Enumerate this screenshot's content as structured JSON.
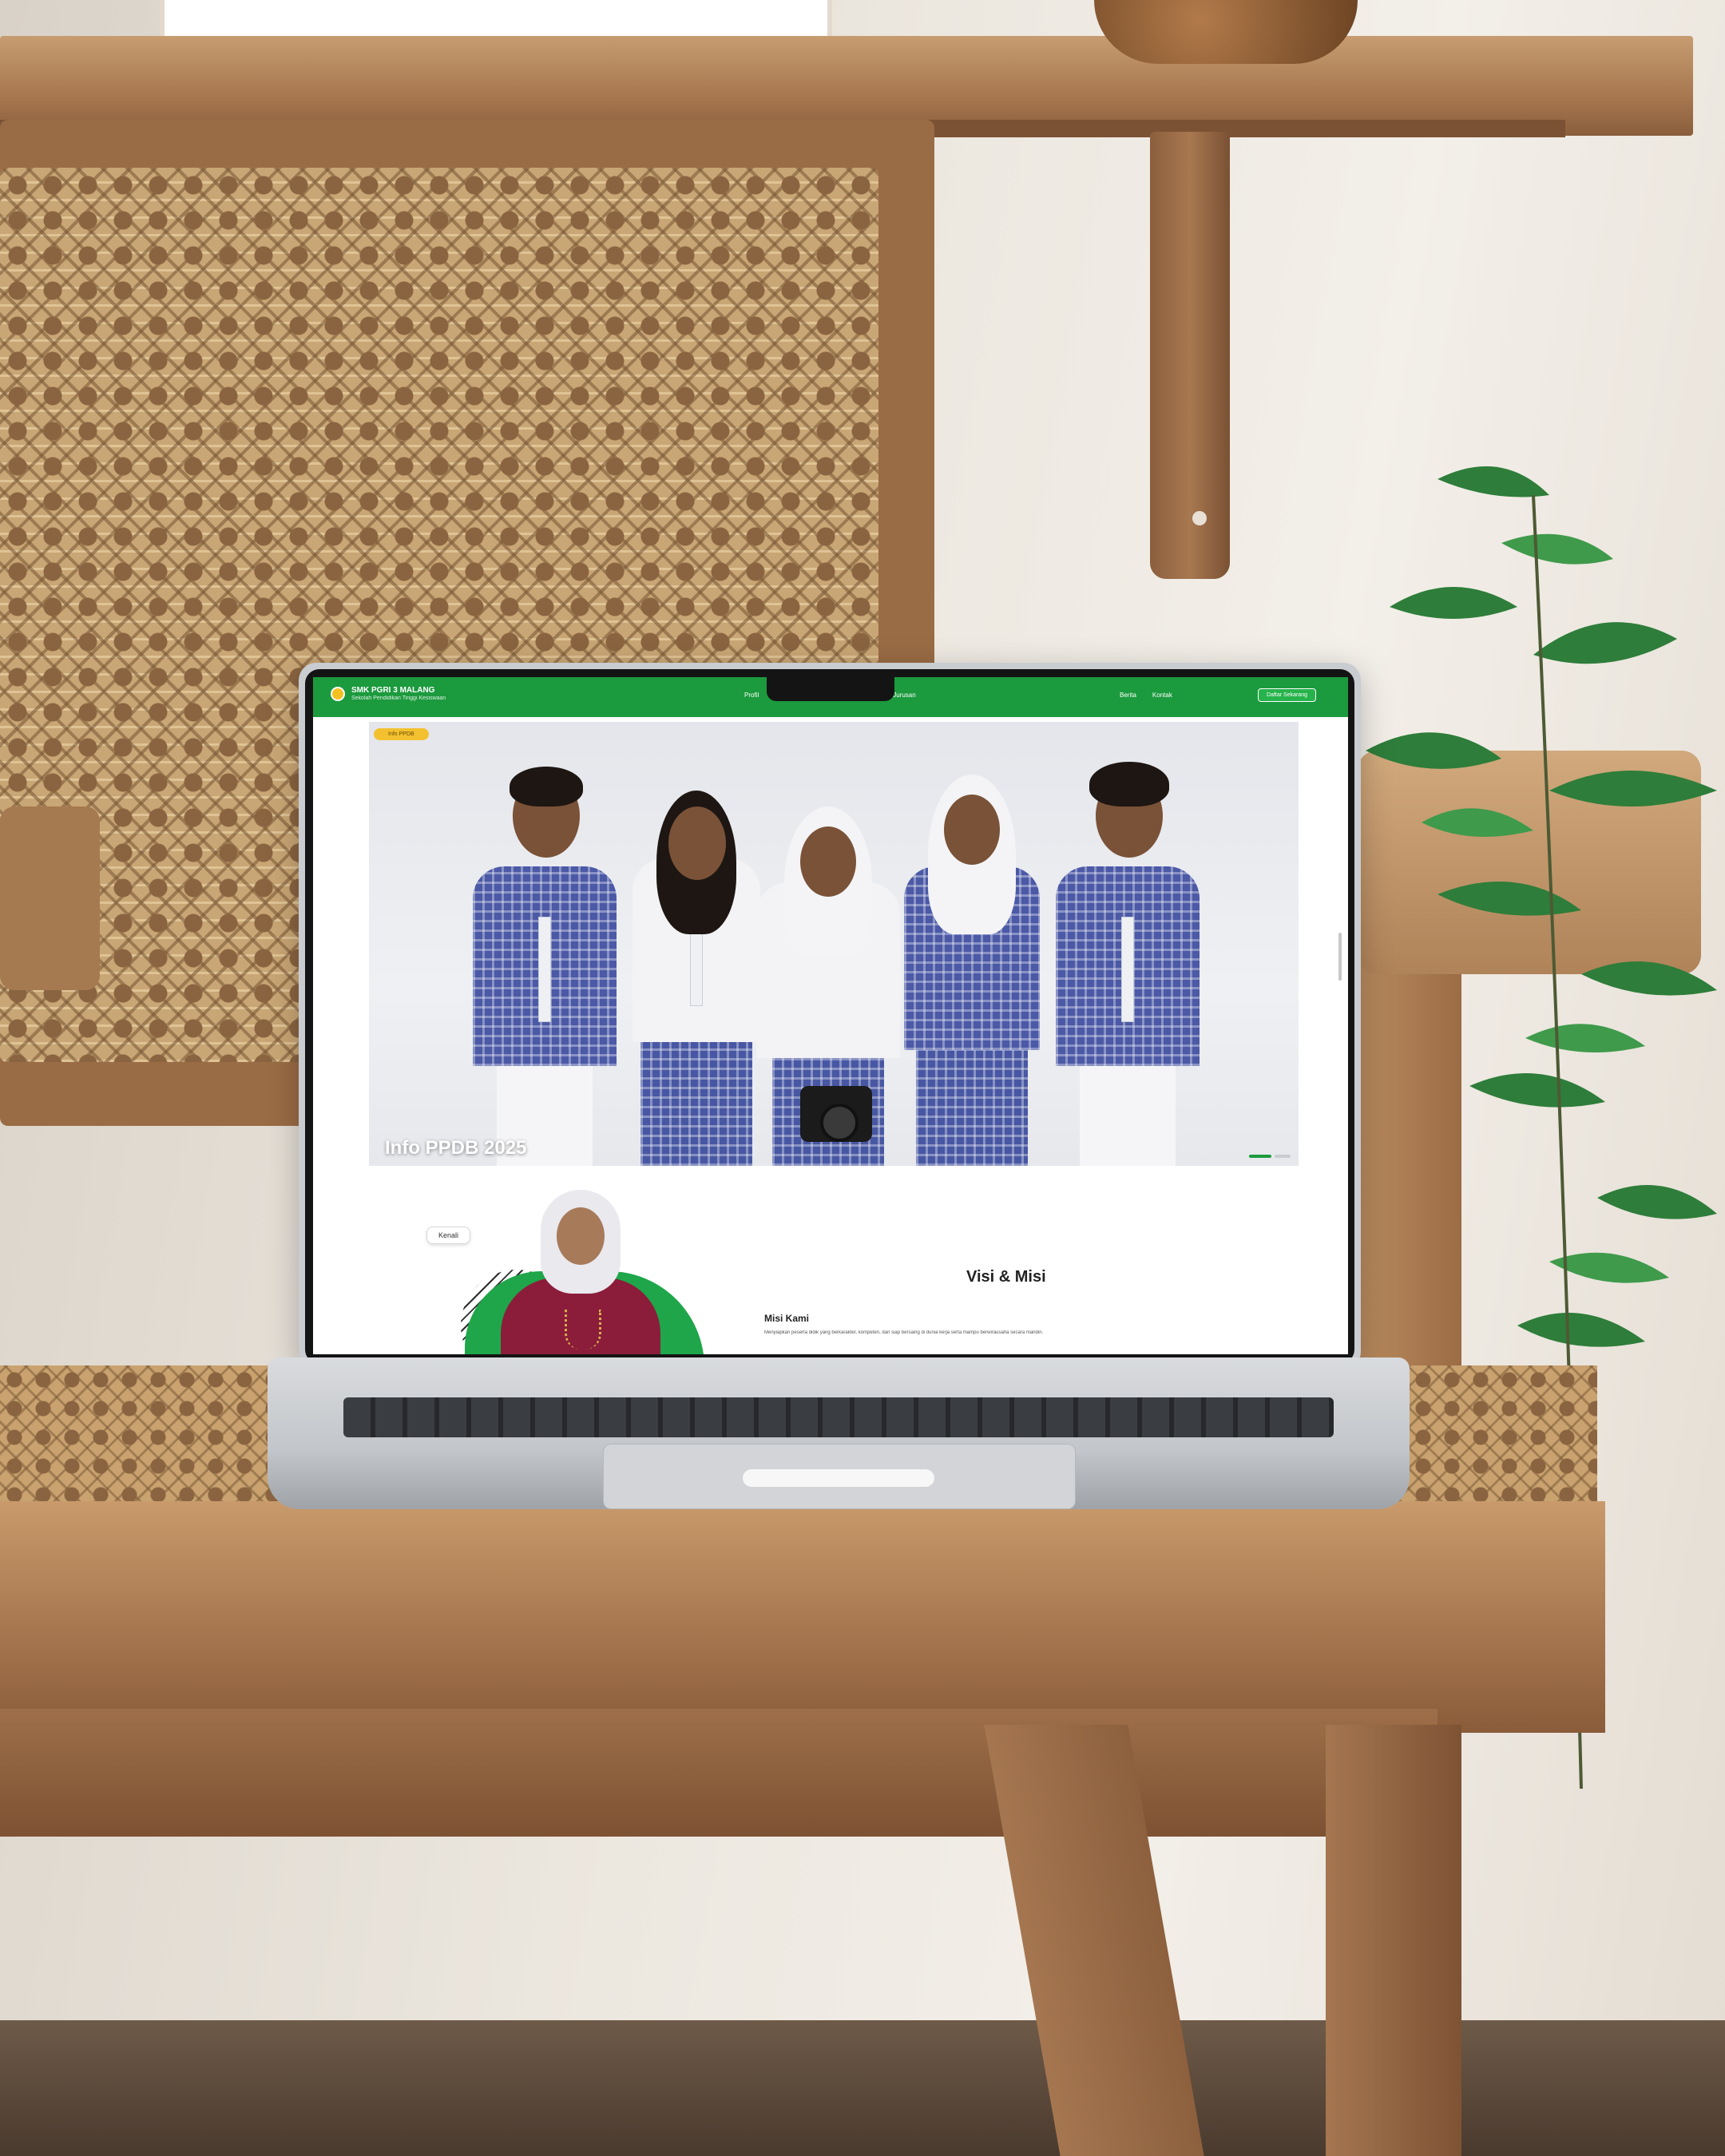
{
  "site": {
    "brand_name": "SMK PGRI 3 MALANG",
    "brand_tagline": "Sekolah Pendidikan Tinggi Kesiswaan",
    "nav_items": [
      "Profil",
      "Jurusan",
      "Berita",
      "Kontak"
    ],
    "cta_label": "Daftar Sekarang"
  },
  "hero": {
    "badge": "Info PPDB",
    "title": "Info PPDB 2025",
    "slides_total": 3,
    "slide_active": 1
  },
  "about": {
    "button_label": "Kenali",
    "section_title": "Visi & Misi",
    "misi_label": "Misi Kami",
    "misi_text": "Menyiapkan peserta didik yang berkarakter, kompeten, dan siap bersaing di dunia kerja serta mampu berwirausaha secara mandiri."
  },
  "colors": {
    "brand_green": "#1c9a3e",
    "accent_yellow": "#f3c130",
    "uniform_blue": "#4b59a6",
    "blazer_maroon": "#8b1d3b"
  }
}
